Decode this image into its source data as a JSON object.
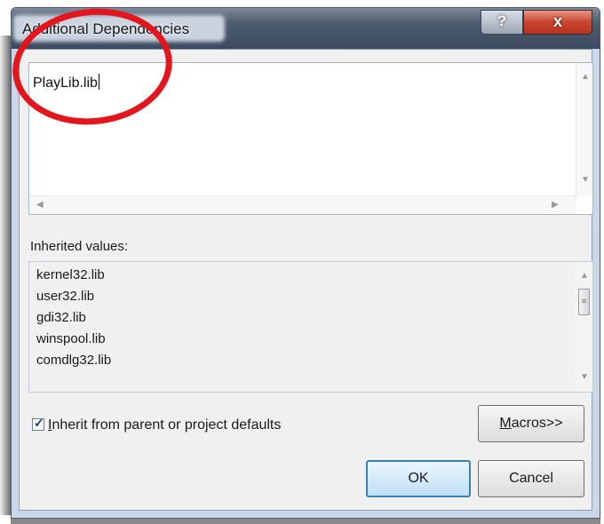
{
  "window": {
    "title": "Additional Dependencies",
    "help_label": "?",
    "close_label": "x"
  },
  "editor": {
    "value": "PlayLib.lib"
  },
  "inherited": {
    "label": "Inherited values:",
    "items": [
      "kernel32.lib",
      "user32.lib",
      "gdi32.lib",
      "winspool.lib",
      "comdlg32.lib"
    ]
  },
  "inherit_checkbox": {
    "checked": true,
    "label_first": "I",
    "label_rest": "nherit from parent or project defaults"
  },
  "buttons": {
    "macros_first": "M",
    "macros_rest": "acros>>",
    "ok": "OK",
    "cancel": "Cancel"
  },
  "annotation": {
    "color": "#e3151d",
    "shape": "ellipse"
  },
  "colors": {
    "title_bar": "#4f5d70",
    "close_button": "#c8452f",
    "ok_border": "#3c7fb1"
  }
}
